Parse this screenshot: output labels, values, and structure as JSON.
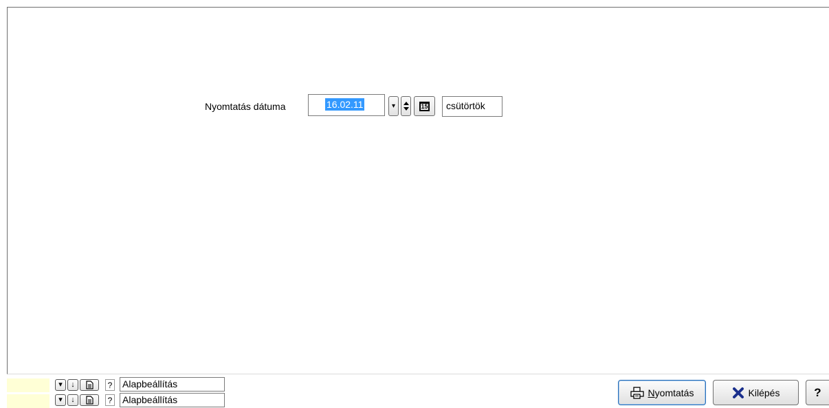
{
  "form": {
    "print_date_label": "Nyomtatás dátuma",
    "print_date_value": "16.02.11",
    "day_of_week": "csütörtök",
    "calendar_glyph": "15"
  },
  "settings_rows": [
    {
      "label": "Alapbeállítás"
    },
    {
      "label": "Alapbeállítás"
    }
  ],
  "buttons": {
    "print_label": "Nyomtatás",
    "exit_label": "Kilépés",
    "help_label": "?"
  },
  "glyphs": {
    "dropdown": "▾",
    "down_arrow": "↓",
    "question": "?"
  },
  "colors": {
    "selection": "#3399ff",
    "yellow_field": "#ffffd6",
    "exit_x": "#1a2f8c"
  }
}
